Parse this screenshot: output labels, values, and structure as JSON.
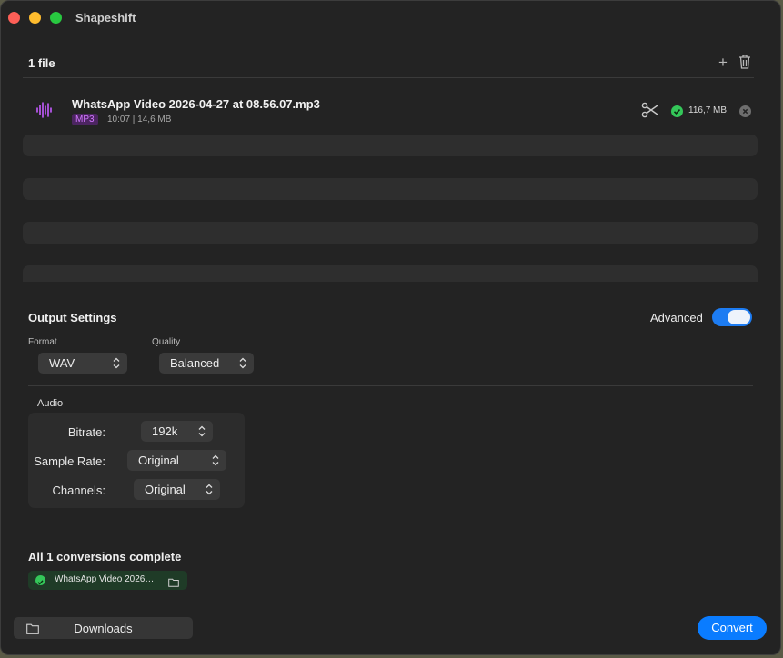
{
  "window": {
    "title": "Shapeshift"
  },
  "files": {
    "header": "1 file",
    "items": [
      {
        "name": "WhatsApp Video 2026-04-27 at 08.56.07.mp3",
        "format_badge": "MP3",
        "meta": "10:07 | 14,6 MB",
        "output_size": "116,7 MB",
        "status_icon": "check-circle-icon",
        "badge_color": "#d277ff"
      }
    ]
  },
  "output_settings": {
    "title": "Output Settings",
    "advanced_label": "Advanced",
    "advanced_enabled": true,
    "format": {
      "label": "Format",
      "value": "WAV"
    },
    "quality": {
      "label": "Quality",
      "value": "Balanced"
    },
    "audio": {
      "label": "Audio",
      "bitrate": {
        "label": "Bitrate:",
        "value": "192k"
      },
      "sample_rate": {
        "label": "Sample Rate:",
        "value": "Original"
      },
      "channels": {
        "label": "Channels:",
        "value": "Original"
      }
    }
  },
  "results": {
    "title": "All 1 conversions complete",
    "items": [
      {
        "name": "WhatsApp Video 2026…"
      }
    ]
  },
  "footer": {
    "downloads_label": "Downloads",
    "convert_label": "Convert"
  },
  "colors": {
    "accent": "#0a7cff",
    "success": "#34c759",
    "background": "#232323"
  }
}
